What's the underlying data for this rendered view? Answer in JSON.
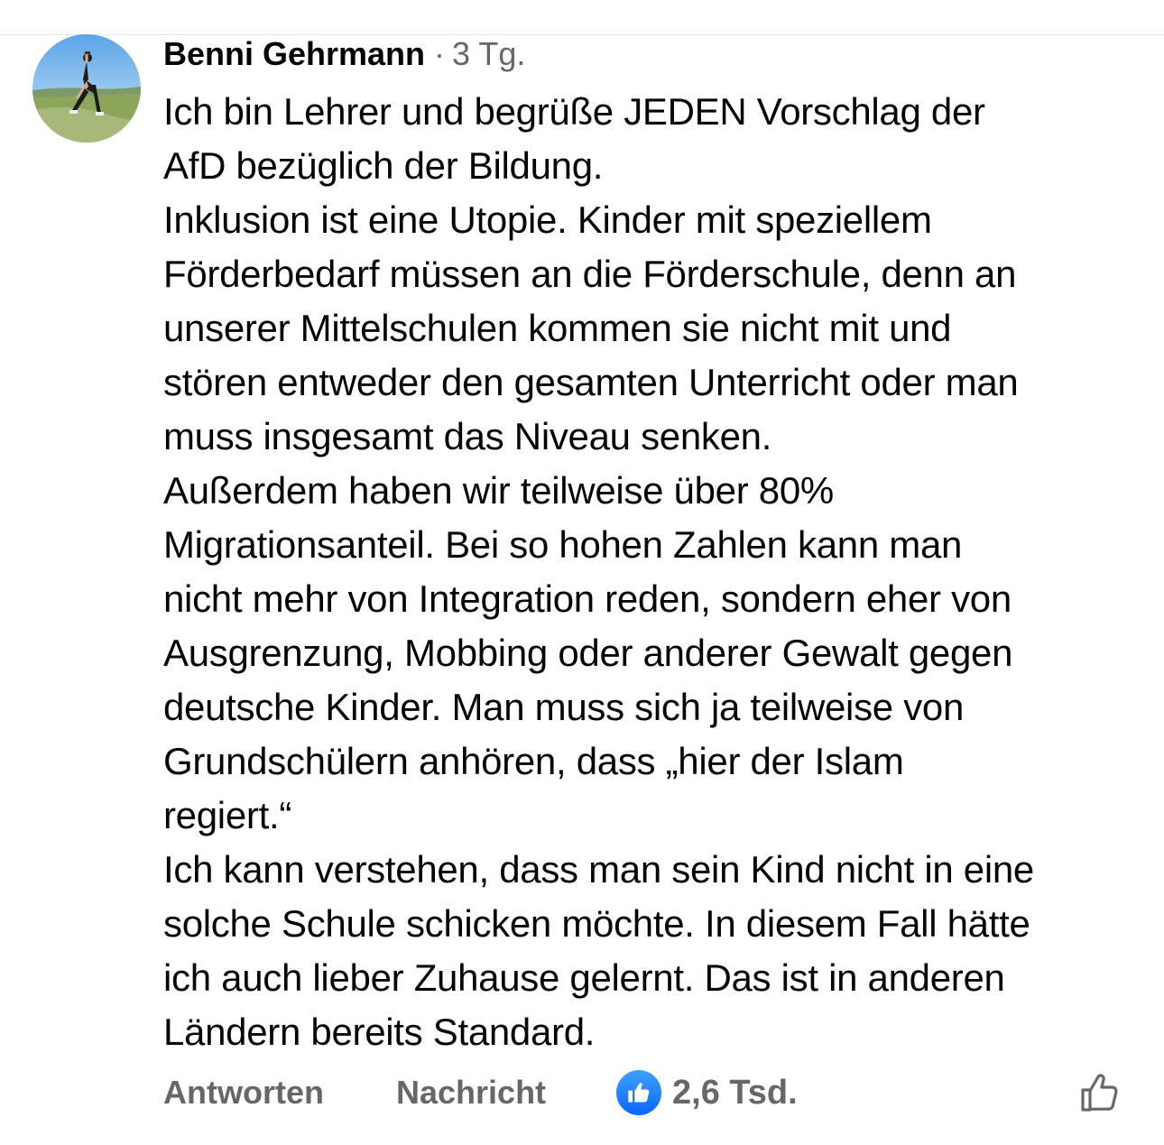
{
  "comment": {
    "author": "Benni Gehrmann",
    "separator": "·",
    "timestamp": "3 Tg.",
    "avatar_icon": "profile-photo",
    "text_lines": [
      "Ich bin Lehrer und begrüße JEDEN Vorschlag der",
      "AfD bezüglich der Bildung.",
      "Inklusion ist eine Utopie. Kinder mit speziellem",
      "Förderbedarf müssen an die Förderschule, denn an",
      "unserer Mittelschulen kommen sie nicht mit und",
      "stören entweder den gesamten Unterricht oder man",
      "muss insgesamt das Niveau senken.",
      "Außerdem haben wir teilweise über 80%",
      "Migrationsanteil. Bei so hohen Zahlen kann man",
      "nicht mehr von Integration reden, sondern eher von",
      "Ausgrenzung, Mobbing oder anderer Gewalt gegen",
      "deutsche Kinder. Man muss sich ja teilweise von",
      "Grundschülern anhören, dass „hier der Islam",
      "regiert.“",
      "Ich kann verstehen, dass man sein Kind nicht in eine",
      "solche Schule schicken möchte. In diesem Fall hätte",
      "ich auch lieber Zuhause gelernt. Das ist in anderen",
      "Ländern bereits Standard."
    ]
  },
  "actions": {
    "reply_label": "Antworten",
    "message_label": "Nachricht",
    "reaction_icon": "like-icon",
    "reaction_count": "2,6 Tsd.",
    "like_button_icon": "thumbs-up-outline-icon"
  },
  "colors": {
    "text": "#050505",
    "secondary": "#65676b",
    "like_blue": "#0866ff",
    "divider": "#e4e6eb"
  }
}
